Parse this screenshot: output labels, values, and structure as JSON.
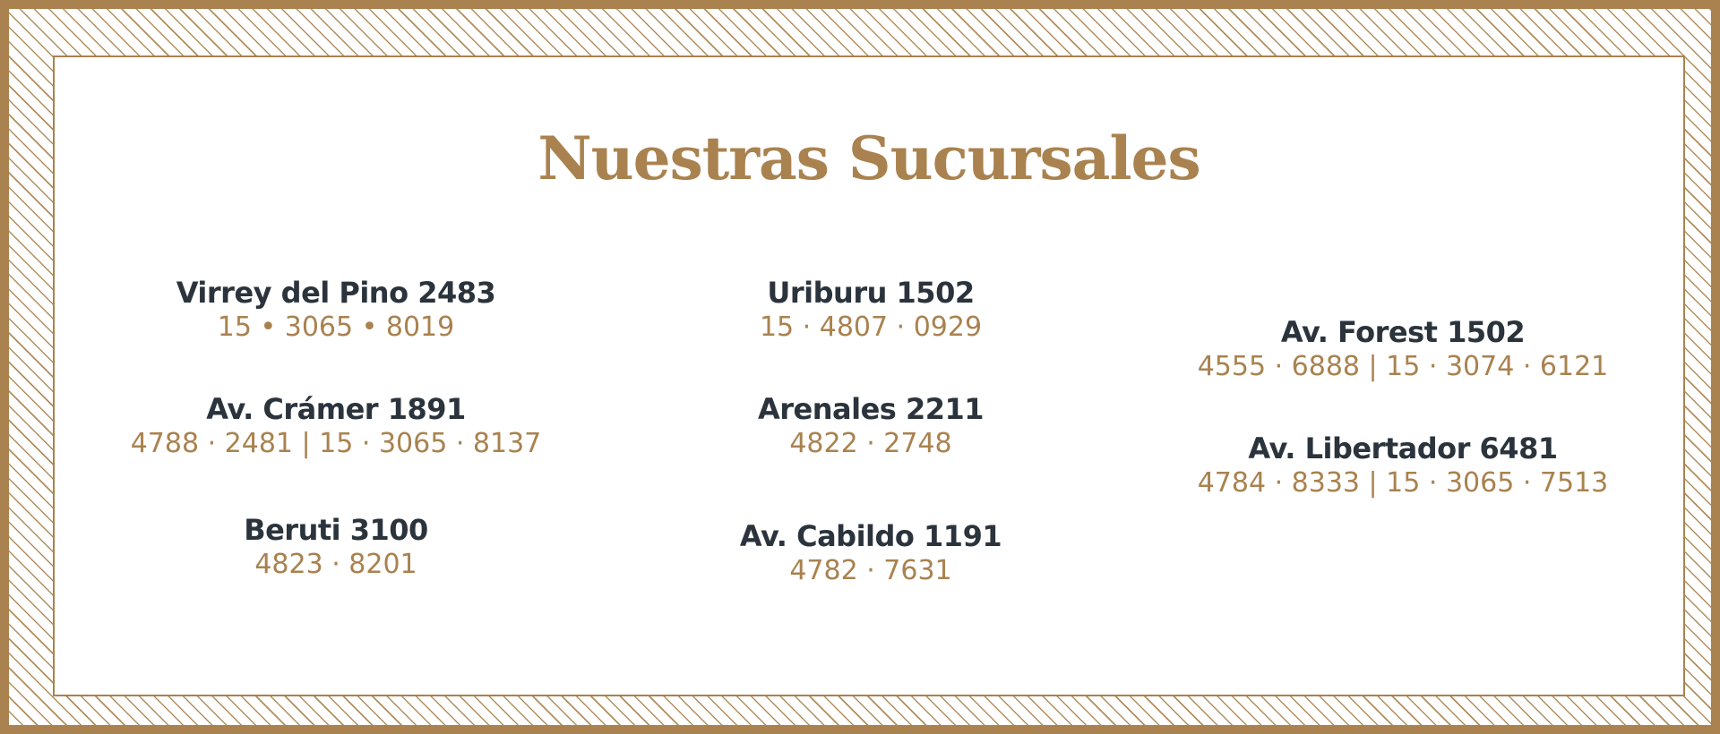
{
  "title": "Nuestras Sucursales",
  "columns": [
    [
      {
        "name": "Virrey del Pino 2483",
        "phone": "15 • 3065 • 8019"
      },
      {
        "name": "Av. Crámer 1891",
        "phone": "4788 · 2481 | 15 · 3065 · 8137"
      },
      {
        "name": "Beruti 3100",
        "phone": "4823 · 8201"
      }
    ],
    [
      {
        "name": "Uriburu 1502",
        "phone": "15 · 4807 · 0929"
      },
      {
        "name": "Arenales 2211",
        "phone": "4822 · 2748"
      },
      {
        "name": "Av. Cabildo 1191",
        "phone": "4782 · 7631"
      }
    ],
    [
      {
        "name": "Av. Forest 1502",
        "phone": "4555 · 6888 | 15 · 3074 · 6121"
      },
      {
        "name": "Av. Libertador 6481",
        "phone": "4784 · 8333 | 15 · 3065 · 7513"
      }
    ]
  ],
  "colors": {
    "accent": "#a9824f",
    "text_dark": "#2b333c",
    "background": "#ffffff"
  }
}
